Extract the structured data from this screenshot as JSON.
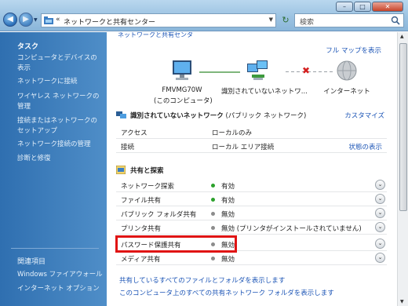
{
  "addressbar": {
    "path": "ネットワークと共有センター",
    "search_placeholder": "検索"
  },
  "sidebar": {
    "tasks_heading": "タスク",
    "tasks": [
      "コンピュータとデバイスの表示",
      "ネットワークに接続",
      "ワイヤレス ネットワークの管理",
      "接続またはネットワークのセットアップ",
      "ネットワーク接続の管理",
      "診断と修復"
    ],
    "related_heading": "関連項目",
    "related": [
      "Windows ファイアウォール",
      "インターネット オプション"
    ]
  },
  "main": {
    "top_link": "ネットワークと共有センタ",
    "full_map": "フル マップを表示",
    "map": {
      "computer_name": "FMVMG70W",
      "computer_sub": "(このコンピュータ)",
      "network_label": "識別されていないネットワ...",
      "internet_label": "インターネット"
    },
    "network": {
      "title": "識別されていないネットワーク",
      "type": "(パブリック ネットワーク)",
      "customize": "カスタマイズ",
      "rows": [
        {
          "key": "アクセス",
          "value": "ローカルのみ"
        },
        {
          "key": "接続",
          "value": "ローカル エリア接続",
          "action": "状態の表示"
        }
      ]
    },
    "sharing": {
      "heading": "共有と探索",
      "rows": [
        {
          "key": "ネットワーク探索",
          "value": "有効",
          "status": "on"
        },
        {
          "key": "ファイル共有",
          "value": "有効",
          "status": "on"
        },
        {
          "key": "パブリック フォルダ共有",
          "value": "無効",
          "status": "off"
        },
        {
          "key": "プリンタ共有",
          "value": "無効 (プリンタがインストールされていません)",
          "status": "off"
        },
        {
          "key": "パスワード保護共有",
          "value": "無効",
          "status": "off"
        },
        {
          "key": "メディア共有",
          "value": "無効",
          "status": "off"
        }
      ]
    },
    "bottom_links": [
      "共有しているすべてのファイルとフォルダを表示します",
      "このコンピュータ上のすべての共有ネットワーク フォルダを表示します"
    ]
  },
  "colors": {
    "accent": "#1c55b6",
    "status_on": "#2ca12c",
    "status_off": "#8c8c8c",
    "highlight": "#e01414"
  }
}
